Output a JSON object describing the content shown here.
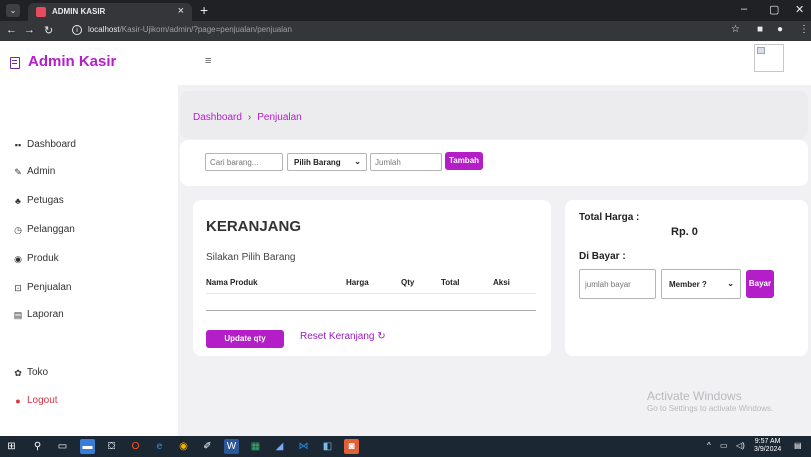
{
  "browser": {
    "tab_title": "ADMIN KASIR",
    "tab_close": "×",
    "new_tab": "+",
    "url_host": "localhost",
    "url_path": "/Kasir-Ujikom/admin/?page=penjualan/penjualan",
    "window_minimize": "–",
    "window_restore": "▢",
    "window_close": "✕"
  },
  "brand": {
    "title": "Admin Kasir"
  },
  "sidebar": {
    "items": [
      {
        "label": "Dashboard",
        "icon": "dashboard-icon"
      },
      {
        "label": "Admin",
        "icon": "pen-icon"
      },
      {
        "label": "Petugas",
        "icon": "users-icon"
      },
      {
        "label": "Pelanggan",
        "icon": "clock-icon"
      },
      {
        "label": "Produk",
        "icon": "product-icon"
      },
      {
        "label": "Penjualan",
        "icon": "cart-icon"
      },
      {
        "label": "Laporan",
        "icon": "report-icon"
      },
      {
        "label": "Toko",
        "icon": "gear-icon"
      },
      {
        "label": "Logout",
        "icon": "logout-icon"
      }
    ]
  },
  "breadcrumb": {
    "home": "Dashboard",
    "separator": "›",
    "current": "Penjualan"
  },
  "search": {
    "placeholder": "Cari barang...",
    "select_value": "Pilih Barang",
    "qty_placeholder": "Jumlah",
    "add_label": "Tambah"
  },
  "cart": {
    "title": "KERANJANG",
    "empty_text": "Silakan Pilih Barang",
    "columns": [
      "Nama Produk",
      "Harga",
      "Qty",
      "Total",
      "Aksi"
    ],
    "update_label": "Update qty",
    "reset_label": "Reset Keranjang"
  },
  "payment": {
    "total_label": "Total Harga :",
    "total_value": "Rp. 0",
    "pay_label": "Di Bayar :",
    "pay_placeholder": "jumlah bayar",
    "member_value": "Member ?",
    "pay_button": "Bayar"
  },
  "watermark": {
    "line1": "Activate Windows",
    "line2": "Go to Settings to activate Windows."
  },
  "taskbar": {
    "time": "9:57 AM",
    "date": "3/9/2024"
  },
  "colors": {
    "accent": "#b31ec8",
    "logout": "#e03040"
  }
}
